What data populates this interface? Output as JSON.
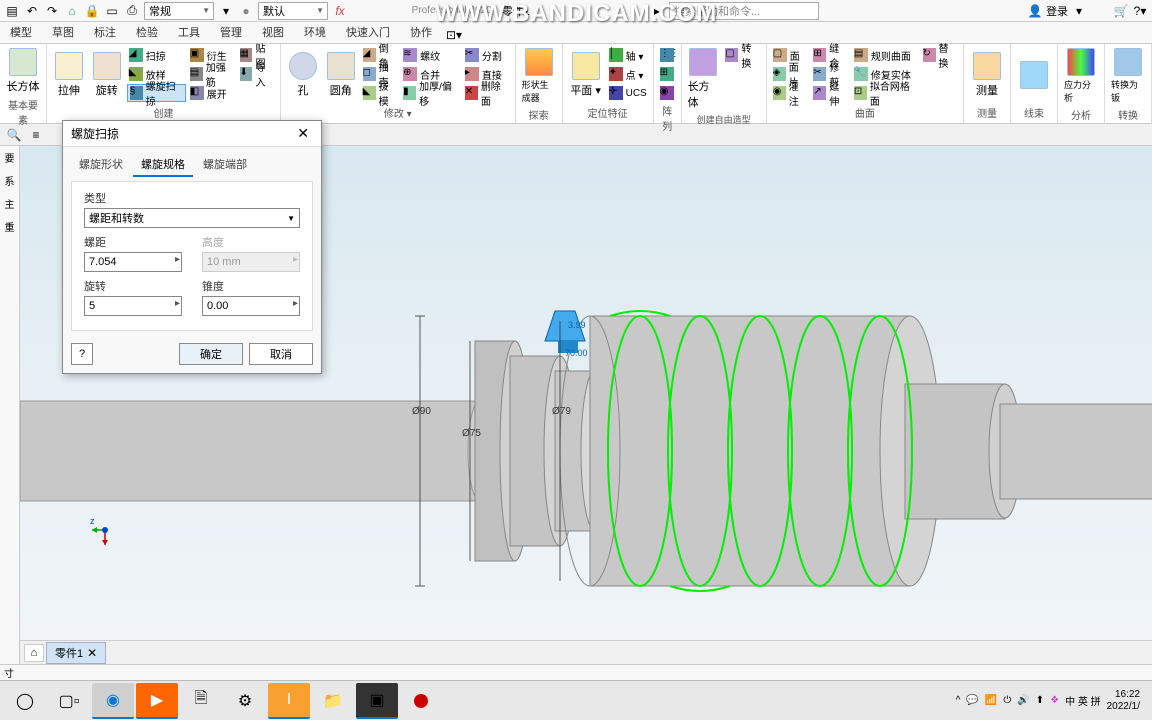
{
  "watermark": "WWW.BANDICAM.COM",
  "app_title_suffix": "Professional 2020",
  "doc_name": "零件1",
  "toolbar1": {
    "style_label": "常规",
    "material_label": "默认",
    "search_placeholder": "搜索帮助和命令...",
    "login_label": "登录"
  },
  "tabs": [
    "模型",
    "草图",
    "标注",
    "检验",
    "工具",
    "管理",
    "视图",
    "环境",
    "快速入门",
    "协作"
  ],
  "ribbon": {
    "groups": [
      {
        "title": "基本要素",
        "big": [
          {
            "label": "长方体"
          }
        ]
      },
      {
        "title": "创建",
        "big": [
          {
            "label": "拉伸"
          },
          {
            "label": "旋转"
          }
        ],
        "small": [
          [
            "扫掠",
            "放样",
            "螺旋扫掠"
          ],
          [
            "衍生",
            "加强筋",
            "展开"
          ],
          [
            "贴图",
            "导入",
            ""
          ]
        ]
      },
      {
        "title": "",
        "big": [
          {
            "label": "孔"
          },
          {
            "label": "圆角"
          }
        ],
        "small": [
          [
            "倒角",
            "抽壳",
            "拔模"
          ],
          [
            "螺纹",
            "合并",
            "加厚/偏移"
          ],
          [
            "分割",
            "直接",
            "删除面"
          ]
        ]
      },
      {
        "title": "修改 ▾",
        "big": []
      },
      {
        "title": "探索",
        "big": [
          {
            "label": "形状生成器"
          }
        ]
      },
      {
        "title": "定位特征",
        "big": [
          {
            "label": "平面 ▾"
          }
        ],
        "small": [
          [
            "轴 ▾",
            "点 ▾",
            "UCS"
          ]
        ]
      },
      {
        "title": "阵列",
        "small": [
          [
            "",
            "",
            ""
          ]
        ]
      },
      {
        "title": "创建自由造型",
        "big": [
          {
            "label": "长方体"
          }
        ],
        "small": [
          [
            "转换",
            ""
          ]
        ]
      },
      {
        "title": "曲面",
        "small": [
          [
            "面",
            "面片",
            "灌注"
          ],
          [
            "缝合",
            "修剪",
            "延伸"
          ],
          [
            "规则曲面",
            "修复实体",
            "拟合网格面"
          ],
          [
            "替换",
            "",
            ""
          ]
        ]
      },
      {
        "title": "测量",
        "big": [
          {
            "label": "测量"
          }
        ]
      },
      {
        "title": "线束",
        "big": [
          {
            "label": ""
          }
        ]
      },
      {
        "title": "分析",
        "big": [
          {
            "label": "应力分析"
          }
        ]
      },
      {
        "title": "转换",
        "big": [
          {
            "label": "转换为钣"
          }
        ]
      }
    ]
  },
  "dialog": {
    "title": "螺旋扫掠",
    "tabs": [
      "螺旋形状",
      "螺旋规格",
      "螺旋端部"
    ],
    "type_label": "类型",
    "type_value": "螺距和转数",
    "pitch_label": "螺距",
    "pitch_value": "7.054",
    "height_label": "高度",
    "height_value": "10 mm",
    "turns_label": "旋转",
    "turns_value": "5",
    "taper_label": "锥度",
    "taper_value": "0.00",
    "help": "?",
    "ok": "确定",
    "cancel": "取消"
  },
  "dims": {
    "d1": "Ø90",
    "d2": "Ø75",
    "d3": "Ø79",
    "v1": "3.99",
    "v2": "70.00"
  },
  "doc_tab": {
    "name": "零件1"
  },
  "status": "寸",
  "axis": {
    "z": "z"
  },
  "taskbar": {
    "time": "16:22",
    "date": "2022/1/",
    "ime": "中 英 拼"
  }
}
